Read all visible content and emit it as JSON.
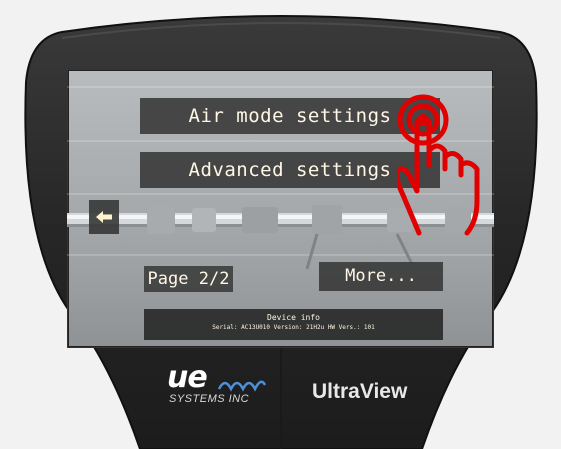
{
  "screen": {
    "air_mode_label": "Air mode settings",
    "advanced_label": "Advanced settings",
    "page_label": "Page 2/2",
    "more_label": "More...",
    "device_info": {
      "title": "Device info",
      "details": "Serial: AC13U010  Version: 21H2u HW Vers.: 101"
    }
  },
  "brand": {
    "logo_text": "ue",
    "logo_subtext": "SYSTEMS INC",
    "product_name": "UltraView"
  },
  "icons": {
    "back": "left-arrow-icon",
    "touch": "tap-hand-icon"
  },
  "colors": {
    "device_body": "#262626",
    "button_bg": "#373737",
    "button_text": "#fff7e6",
    "tap_indicator": "#e00000"
  }
}
